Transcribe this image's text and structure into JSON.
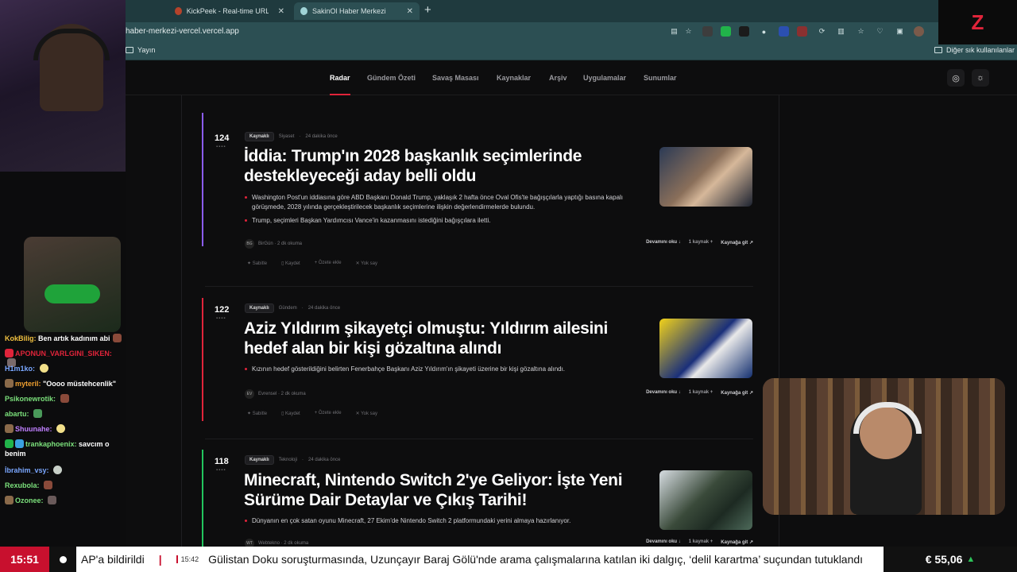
{
  "browser": {
    "tabs": [
      {
        "label": "KickPeek - Real-time URL Crawler",
        "active": false,
        "favicon_color": "#b5432b"
      },
      {
        "label": "SakinOl Haber Merkezi",
        "active": true,
        "favicon_color": "#9fd3d6"
      }
    ],
    "url": "haber-merkezi-vercel.vercel.app",
    "bookmarks": [
      {
        "label": "Yayın"
      }
    ],
    "other_bookmarks": "Diğer sık kullanılanlar"
  },
  "site": {
    "nav": [
      {
        "label": "Radar",
        "active": true
      },
      {
        "label": "Gündem Özeti",
        "active": false
      },
      {
        "label": "Savaş Masası",
        "active": false
      },
      {
        "label": "Kaynaklar",
        "active": false
      },
      {
        "label": "Arşiv",
        "active": false
      },
      {
        "label": "Uygulamalar",
        "active": false
      },
      {
        "label": "Sunumlar",
        "active": false
      }
    ],
    "accent_color": "#e0243a",
    "articles": [
      {
        "rank": "124",
        "badge": "Kaynaklı",
        "category": "Siyaset",
        "time": "24 dakika önce",
        "accent": "#8b5cf6",
        "headline": "İddia: Trump'ın 2028 başkanlık seçimlerinde destekleyeceği aday belli oldu",
        "bullets": [
          "Washington Post'un iddiasına göre ABD Başkanı Donald Trump, yaklaşık 2 hafta önce Oval Ofis'te bağışçılarla yaptığı basına kapalı görüşmede, 2028 yılında gerçekleştirilecek başkanlık seçimlerine ilişkin değerlendirmelerde bulundu.",
          "Trump, seçimleri Başkan Yardımcısı Vance'in kazanmasını istediğini bağışçılara iletti."
        ],
        "source": "BirGün · 2 dk okuma",
        "source_logo": "BG",
        "read_more": "Devamını oku ↓",
        "source_count": "1 kaynak +",
        "go_source": "Kaynağa git ↗",
        "tools": [
          "Sabitle",
          "Kaydet",
          "Özete ekle",
          "Yok say"
        ]
      },
      {
        "rank": "122",
        "badge": "Kaynaklı",
        "category": "Gündem",
        "time": "24 dakika önce",
        "accent": "#e0243a",
        "headline": "Aziz Yıldırım şikayetçi olmuştu: Yıldırım ailesini hedef alan bir kişi gözaltına alındı",
        "bullets": [
          "Kızının hedef gösterildiğini belirten Fenerbahçe Başkanı Aziz Yıldırım'ın şikayeti üzerine bir kişi gözaltına alındı."
        ],
        "source": "Evrensel · 2 dk okuma",
        "source_logo": "EV",
        "read_more": "Devamını oku ↓",
        "source_count": "1 kaynak +",
        "go_source": "Kaynağa git ↗",
        "tools": [
          "Sabitle",
          "Kaydet",
          "Özete ekle",
          "Yok say"
        ]
      },
      {
        "rank": "118",
        "badge": "Kaynaklı",
        "category": "Teknoloji",
        "time": "24 dakika önce",
        "accent": "#22c55e",
        "headline": "Minecraft, Nintendo Switch 2'ye Geliyor: İşte Yeni Sürüme Dair Detaylar ve Çıkış Tarihi!",
        "bullets": [
          "Dünyanın en çok satan oyunu Minecraft, 27 Ekim'de Nintendo Switch 2 platformundaki yerini almaya hazırlanıyor."
        ],
        "source": "Webtekno · 2 dk okuma",
        "source_logo": "WT",
        "read_more": "Devamını oku ↓",
        "source_count": "1 kaynak +",
        "go_source": "Kaynağa git ↗",
        "tools": [
          "Sabitle",
          "Kaydet",
          "Özete ekle",
          "Yok say"
        ]
      }
    ]
  },
  "chat": [
    {
      "user": "KokBilig:",
      "msg": "Ben artık kadınım abi",
      "color": "#f0c040"
    },
    {
      "user": "APONUN_VARLGINI_SIKEN:",
      "msg": "",
      "color": "#e0243a"
    },
    {
      "user": "H1m1ko:",
      "msg": "",
      "color": "#7aa7ff"
    },
    {
      "user": "myteril:",
      "msg": "\"Oooo müstehcenlik\"",
      "color": "#f0a030"
    },
    {
      "user": "Psikonewrotik:",
      "msg": "",
      "color": "#7be07b"
    },
    {
      "user": "abartu:",
      "msg": "",
      "color": "#7be07b"
    },
    {
      "user": "Shuunahe:",
      "msg": "",
      "color": "#c080ff"
    },
    {
      "user": "trankaphoenix:",
      "msg": "savcım o benim",
      "color": "#7be07b"
    },
    {
      "user": "İbrahim_vsy:",
      "msg": "",
      "color": "#7aa7ff"
    },
    {
      "user": "Rexubola:",
      "msg": "",
      "color": "#7be07b"
    },
    {
      "user": "Ozonee:",
      "msg": "",
      "color": "#7be07b"
    }
  ],
  "ticker": {
    "clock": "15:51",
    "prev_headline_tail": "AP'a bildirildi",
    "item_time": "15:42",
    "headline": "Gülistan Doku soruşturmasında, Uzunçayır Baraj Gölü'nde arama çalışmalarına katılan iki dalgıç, ‘delil karartma’ suçundan tutuklandı",
    "fx": "€ 55,06",
    "fx_dir": "▲"
  },
  "brand_logo": "Z"
}
